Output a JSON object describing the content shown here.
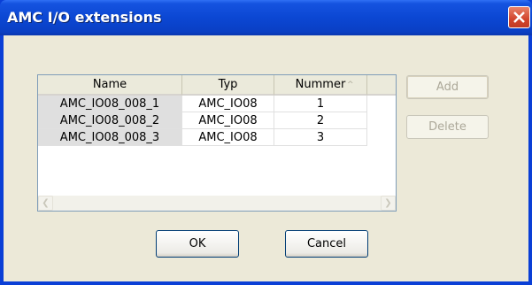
{
  "window": {
    "title": "AMC I/O extensions"
  },
  "listview": {
    "columns": [
      {
        "label": "Name"
      },
      {
        "label": "Typ"
      },
      {
        "label": "Nummer",
        "sort_indicator": "^"
      }
    ],
    "rows": [
      {
        "name": "AMC_IO08_008_1",
        "typ": "AMC_IO08",
        "nummer": "1"
      },
      {
        "name": "AMC_IO08_008_2",
        "typ": "AMC_IO08",
        "nummer": "2"
      },
      {
        "name": "AMC_IO08_008_3",
        "typ": "AMC_IO08",
        "nummer": "3"
      }
    ]
  },
  "buttons": {
    "add": "Add",
    "delete": "Delete",
    "ok": "OK",
    "cancel": "Cancel"
  },
  "colors": {
    "titlebar": "#0a47d3",
    "close": "#d2452d",
    "dialog_bg": "#ece9d8",
    "first_col_bg": "#dfdfdf"
  }
}
